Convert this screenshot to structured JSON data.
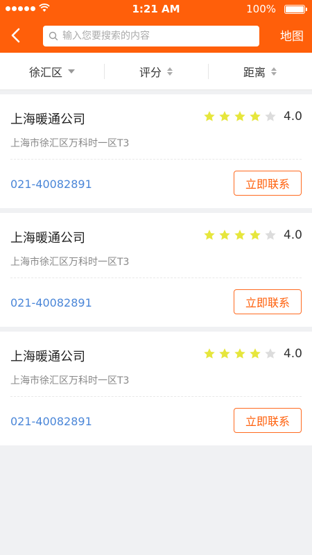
{
  "status_bar": {
    "time": "1:21 AM",
    "battery": "100%"
  },
  "nav": {
    "back_icon": "chevron-left-icon",
    "search_placeholder": "输入您要搜索的内容",
    "map_label": "地图"
  },
  "filters": [
    {
      "label": "徐汇区",
      "indicator": "triangle-down-icon"
    },
    {
      "label": "评分",
      "indicator": "sort-icon"
    },
    {
      "label": "距离",
      "indicator": "sort-icon"
    }
  ],
  "companies": [
    {
      "name": "上海暖通公司",
      "rating": "4.0",
      "stars_filled": 4,
      "stars_total": 5,
      "address": "上海市徐汇区万科时一区T3",
      "phone": "021-40082891",
      "contact_label": "立即联系"
    },
    {
      "name": "上海暖通公司",
      "rating": "4.0",
      "stars_filled": 4,
      "stars_total": 5,
      "address": "上海市徐汇区万科时一区T3",
      "phone": "021-40082891",
      "contact_label": "立即联系"
    },
    {
      "name": "上海暖通公司",
      "rating": "4.0",
      "stars_filled": 4,
      "stars_total": 5,
      "address": "上海市徐汇区万科时一区T3",
      "phone": "021-40082891",
      "contact_label": "立即联系"
    }
  ],
  "colors": {
    "accent": "#ff5f0a",
    "star_filled": "#e6e63c",
    "star_empty": "#dcdcdc",
    "phone": "#4a86d8"
  }
}
